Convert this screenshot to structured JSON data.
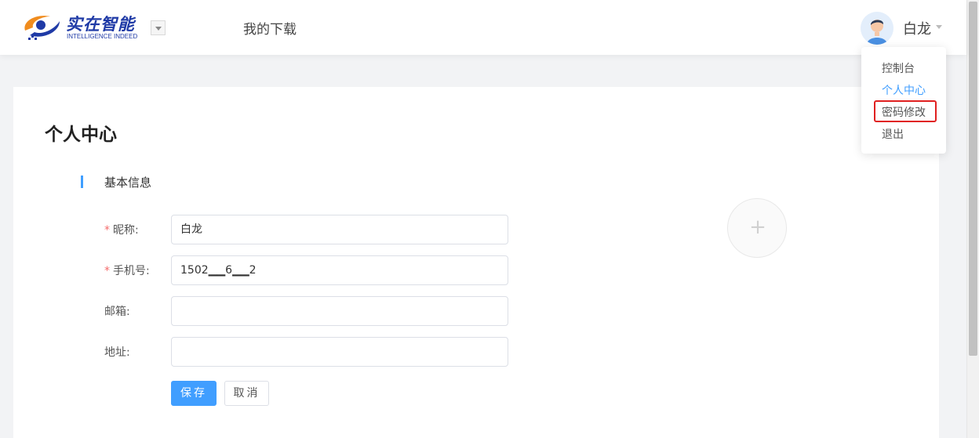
{
  "header": {
    "logo_cn": "实在智能",
    "logo_en": "INTELLIGENCE INDEED",
    "nav_download": "我的下载",
    "username": "白龙"
  },
  "user_menu": {
    "items": [
      {
        "label": "控制台"
      },
      {
        "label": "个人中心"
      },
      {
        "label": "密码修改"
      },
      {
        "label": "退出"
      }
    ]
  },
  "page": {
    "title": "个人中心",
    "section_title": "基本信息",
    "form": {
      "nickname_label": "昵称:",
      "nickname_value": "白龙",
      "phone_label": "手机号:",
      "phone_value": "1502▁▁6▁▁2",
      "email_label": "邮箱:",
      "email_value": "",
      "address_label": "地址:",
      "address_value": "",
      "required_mark": "*"
    },
    "save_label": "保存",
    "cancel_label": "取消",
    "upload_plus": "+"
  },
  "colors": {
    "accent": "#409eff",
    "highlight_border": "#e02020",
    "required": "#f56c6c"
  }
}
